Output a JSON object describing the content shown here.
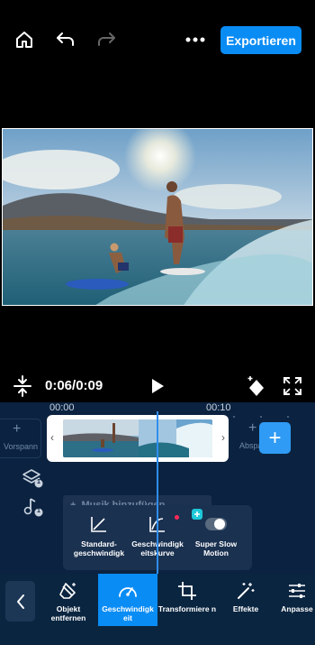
{
  "topbar": {
    "export_label": "Exportieren"
  },
  "controls": {
    "time": "0:06/0:09"
  },
  "timeline": {
    "ruler": [
      "00:00",
      "00:10"
    ],
    "intro_label": "Vorspann",
    "outro_label": "Abspa",
    "add_label": "+",
    "music_label": "Musik hinzufügen",
    "layer_badge": "1",
    "music_badge": "1"
  },
  "speed_panel": {
    "options": [
      {
        "label": "Standard-geschwindigk",
        "icon": "standard-speed-icon"
      },
      {
        "label": "Geschwindigk eitskurve",
        "icon": "speed-curve-icon"
      },
      {
        "label": "Super Slow Motion",
        "icon": "toggle-icon"
      }
    ]
  },
  "toolbar": {
    "tools": [
      {
        "label": "Objekt entfernen",
        "icon": "eraser-icon"
      },
      {
        "label": "Geschwindigk eit",
        "icon": "speedometer-icon"
      },
      {
        "label": "Transformiere n",
        "icon": "crop-icon"
      },
      {
        "label": "Effekte",
        "icon": "magic-wand-icon"
      },
      {
        "label": "Anpasse",
        "icon": "sliders-icon"
      }
    ]
  },
  "colors": {
    "accent": "#0a8cf5",
    "timeline_bg": "#0b2340",
    "panel_bg": "#1a3150"
  }
}
